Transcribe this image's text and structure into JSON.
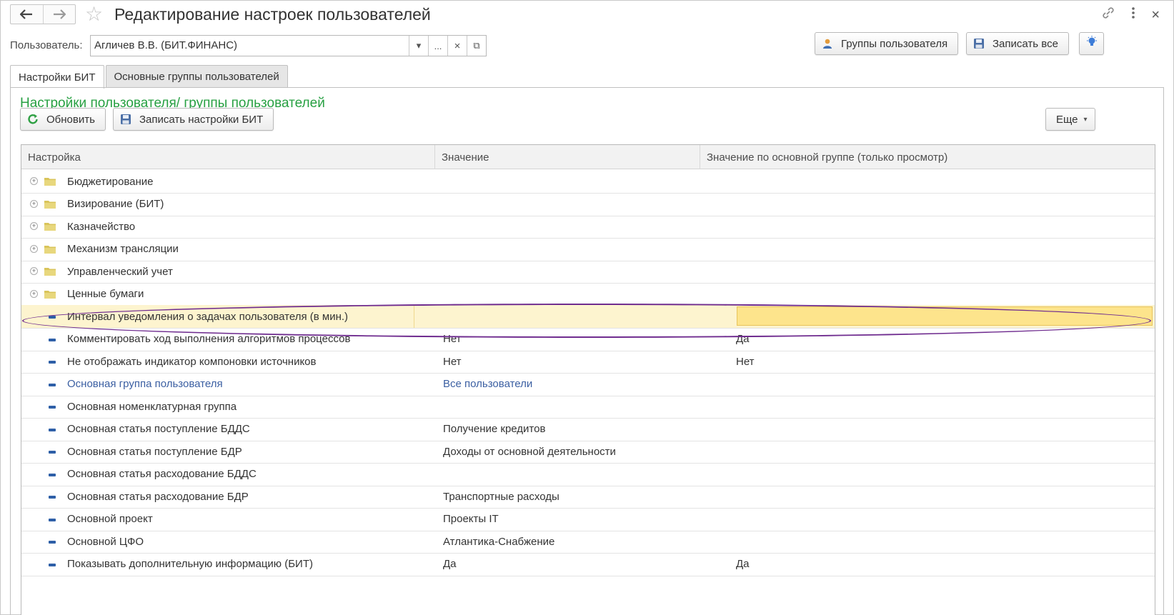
{
  "window": {
    "title": "Редактирование настроек пользователей",
    "back_icon": "arrow-left",
    "forward_icon": "arrow-right",
    "favorite_icon": "star-outline",
    "link_icon": "chain-link",
    "more_icon": "vertical-dots",
    "close_icon": "×"
  },
  "user": {
    "label": "Пользователь:",
    "value": "Агличев В.В. (БИТ.ФИНАНС)",
    "dropdown_glyph": "▾",
    "choose_glyph": "...",
    "clear_glyph": "×",
    "open_glyph": "⧉"
  },
  "toolbar": {
    "groups_button": "Группы пользователя",
    "save_all_button": "Записать все"
  },
  "tabs": [
    {
      "label": "Настройки БИТ",
      "active": true
    },
    {
      "label": "Основные группы пользователей",
      "active": false
    }
  ],
  "section": {
    "title": "Настройки пользователя/ группы пользователей",
    "refresh_button": "Обновить",
    "save_settings_button": "Записать настройки БИТ",
    "more_button": "Еще",
    "more_arrow": "▾"
  },
  "grid": {
    "columns": [
      "Настройка",
      "Значение",
      "Значение по основной группе (только просмотр)"
    ],
    "rows": [
      {
        "type": "group",
        "setting": "Бюджетирование",
        "value": "",
        "group_value": ""
      },
      {
        "type": "group",
        "setting": "Визирование (БИТ)",
        "value": "",
        "group_value": ""
      },
      {
        "type": "group",
        "setting": "Казначейство",
        "value": "",
        "group_value": ""
      },
      {
        "type": "group",
        "setting": "Механизм трансляции",
        "value": "",
        "group_value": ""
      },
      {
        "type": "group",
        "setting": "Управленческий учет",
        "value": "",
        "group_value": ""
      },
      {
        "type": "group",
        "setting": "Ценные бумаги",
        "value": "",
        "group_value": ""
      },
      {
        "type": "item",
        "setting": "Интервал уведомления о задачах пользователя (в мин.)",
        "value": "",
        "group_value": "",
        "selected": true
      },
      {
        "type": "item",
        "setting": "Комментировать ход выполнения алгоритмов процессов",
        "value": "Нет",
        "group_value": "Да"
      },
      {
        "type": "item",
        "setting": "Не отображать индикатор компоновки источников",
        "value": "Нет",
        "group_value": "Нет"
      },
      {
        "type": "item",
        "setting": "Основная группа пользователя",
        "value": "Все пользователи",
        "group_value": "",
        "link": true
      },
      {
        "type": "item",
        "setting": "Основная номенклатурная группа",
        "value": "",
        "group_value": ""
      },
      {
        "type": "item",
        "setting": "Основная статья поступление БДДС",
        "value": "Получение кредитов",
        "group_value": ""
      },
      {
        "type": "item",
        "setting": "Основная статья поступление БДР",
        "value": "Доходы от основной деятельности",
        "group_value": ""
      },
      {
        "type": "item",
        "setting": "Основная статья расходование БДДС",
        "value": "",
        "group_value": ""
      },
      {
        "type": "item",
        "setting": "Основная статья расходование БДР",
        "value": "Транспортные расходы",
        "group_value": ""
      },
      {
        "type": "item",
        "setting": "Основной проект",
        "value": "Проекты IT",
        "group_value": ""
      },
      {
        "type": "item",
        "setting": "Основной ЦФО",
        "value": "Атлантика-Снабжение",
        "group_value": ""
      },
      {
        "type": "item",
        "setting": "Показывать дополнительную информацию (БИТ)",
        "value": "Да",
        "group_value": "Да"
      }
    ]
  },
  "colors": {
    "accent_green": "#27a042",
    "link_blue": "#3b5fa2",
    "selection_row": "#fdf4cf",
    "highlight_cell": "#fde48c",
    "annotation_ellipse": "#6f2c8f"
  }
}
